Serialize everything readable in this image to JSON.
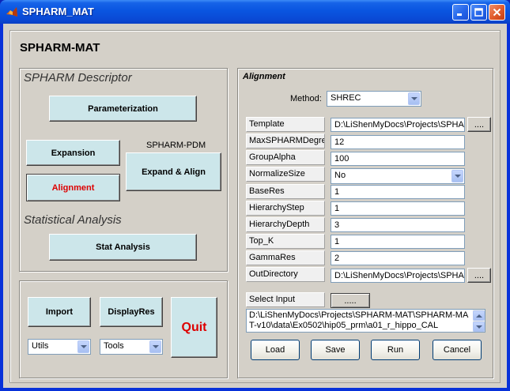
{
  "window": {
    "title": "SPHARM_MAT",
    "minimize_icon": "minimize-icon",
    "maximize_icon": "maximize-icon",
    "close_icon": "close-icon",
    "app_icon": "matlab-logo-icon"
  },
  "main_title": "SPHARM-MAT",
  "descriptor_panel": {
    "title": "SPHARM Descriptor",
    "parameterization_label": "Parameterization",
    "expansion_label": "Expansion",
    "spharm_pdm_label": "SPHARM-PDM",
    "expand_align_label": "Expand & Align",
    "alignment_label": "Alignment",
    "alignment_color": "#dd0000",
    "statistical_title": "Statistical Analysis",
    "stat_analysis_label": "Stat Analysis"
  },
  "bottom_panel": {
    "import_label": "Import",
    "displayres_label": "DisplayRes",
    "quit_label": "Quit",
    "quit_color": "#dd0000",
    "utils_select": "Utils",
    "tools_select": "Tools"
  },
  "alignment_panel": {
    "title": "Alignment",
    "method_label": "Method:",
    "method_value": "SHREC",
    "params": [
      {
        "label": "Template",
        "value": "D:\\LiShenMyDocs\\Projects\\SPHARM",
        "type": "text-browse"
      },
      {
        "label": "MaxSPHARMDegree",
        "value": "12",
        "type": "text"
      },
      {
        "label": "GroupAlpha",
        "value": "100",
        "type": "text"
      },
      {
        "label": "NormalizeSize",
        "value": "No",
        "type": "select"
      },
      {
        "label": "BaseRes",
        "value": "1",
        "type": "text"
      },
      {
        "label": "HierarchyStep",
        "value": "1",
        "type": "text"
      },
      {
        "label": "HierarchyDepth",
        "value": "3",
        "type": "text"
      },
      {
        "label": "Top_K",
        "value": "1",
        "type": "text"
      },
      {
        "label": "GammaRes",
        "value": "2",
        "type": "text"
      },
      {
        "label": "OutDirectory",
        "value": "D:\\LiShenMyDocs\\Projects\\SPHARM",
        "type": "text-browse"
      }
    ],
    "browse_label": "....",
    "select_input_label": "Select Input",
    "select_input_button": ".....",
    "input_list": "D:\\LiShenMyDocs\\Projects\\SPHARM-MAT\\SPHARM-MAT-v10\\data\\Ex0502\\hip05_prm\\a01_r_hippo_CAL",
    "load_label": "Load",
    "save_label": "Save",
    "run_label": "Run",
    "cancel_label": "Cancel"
  }
}
